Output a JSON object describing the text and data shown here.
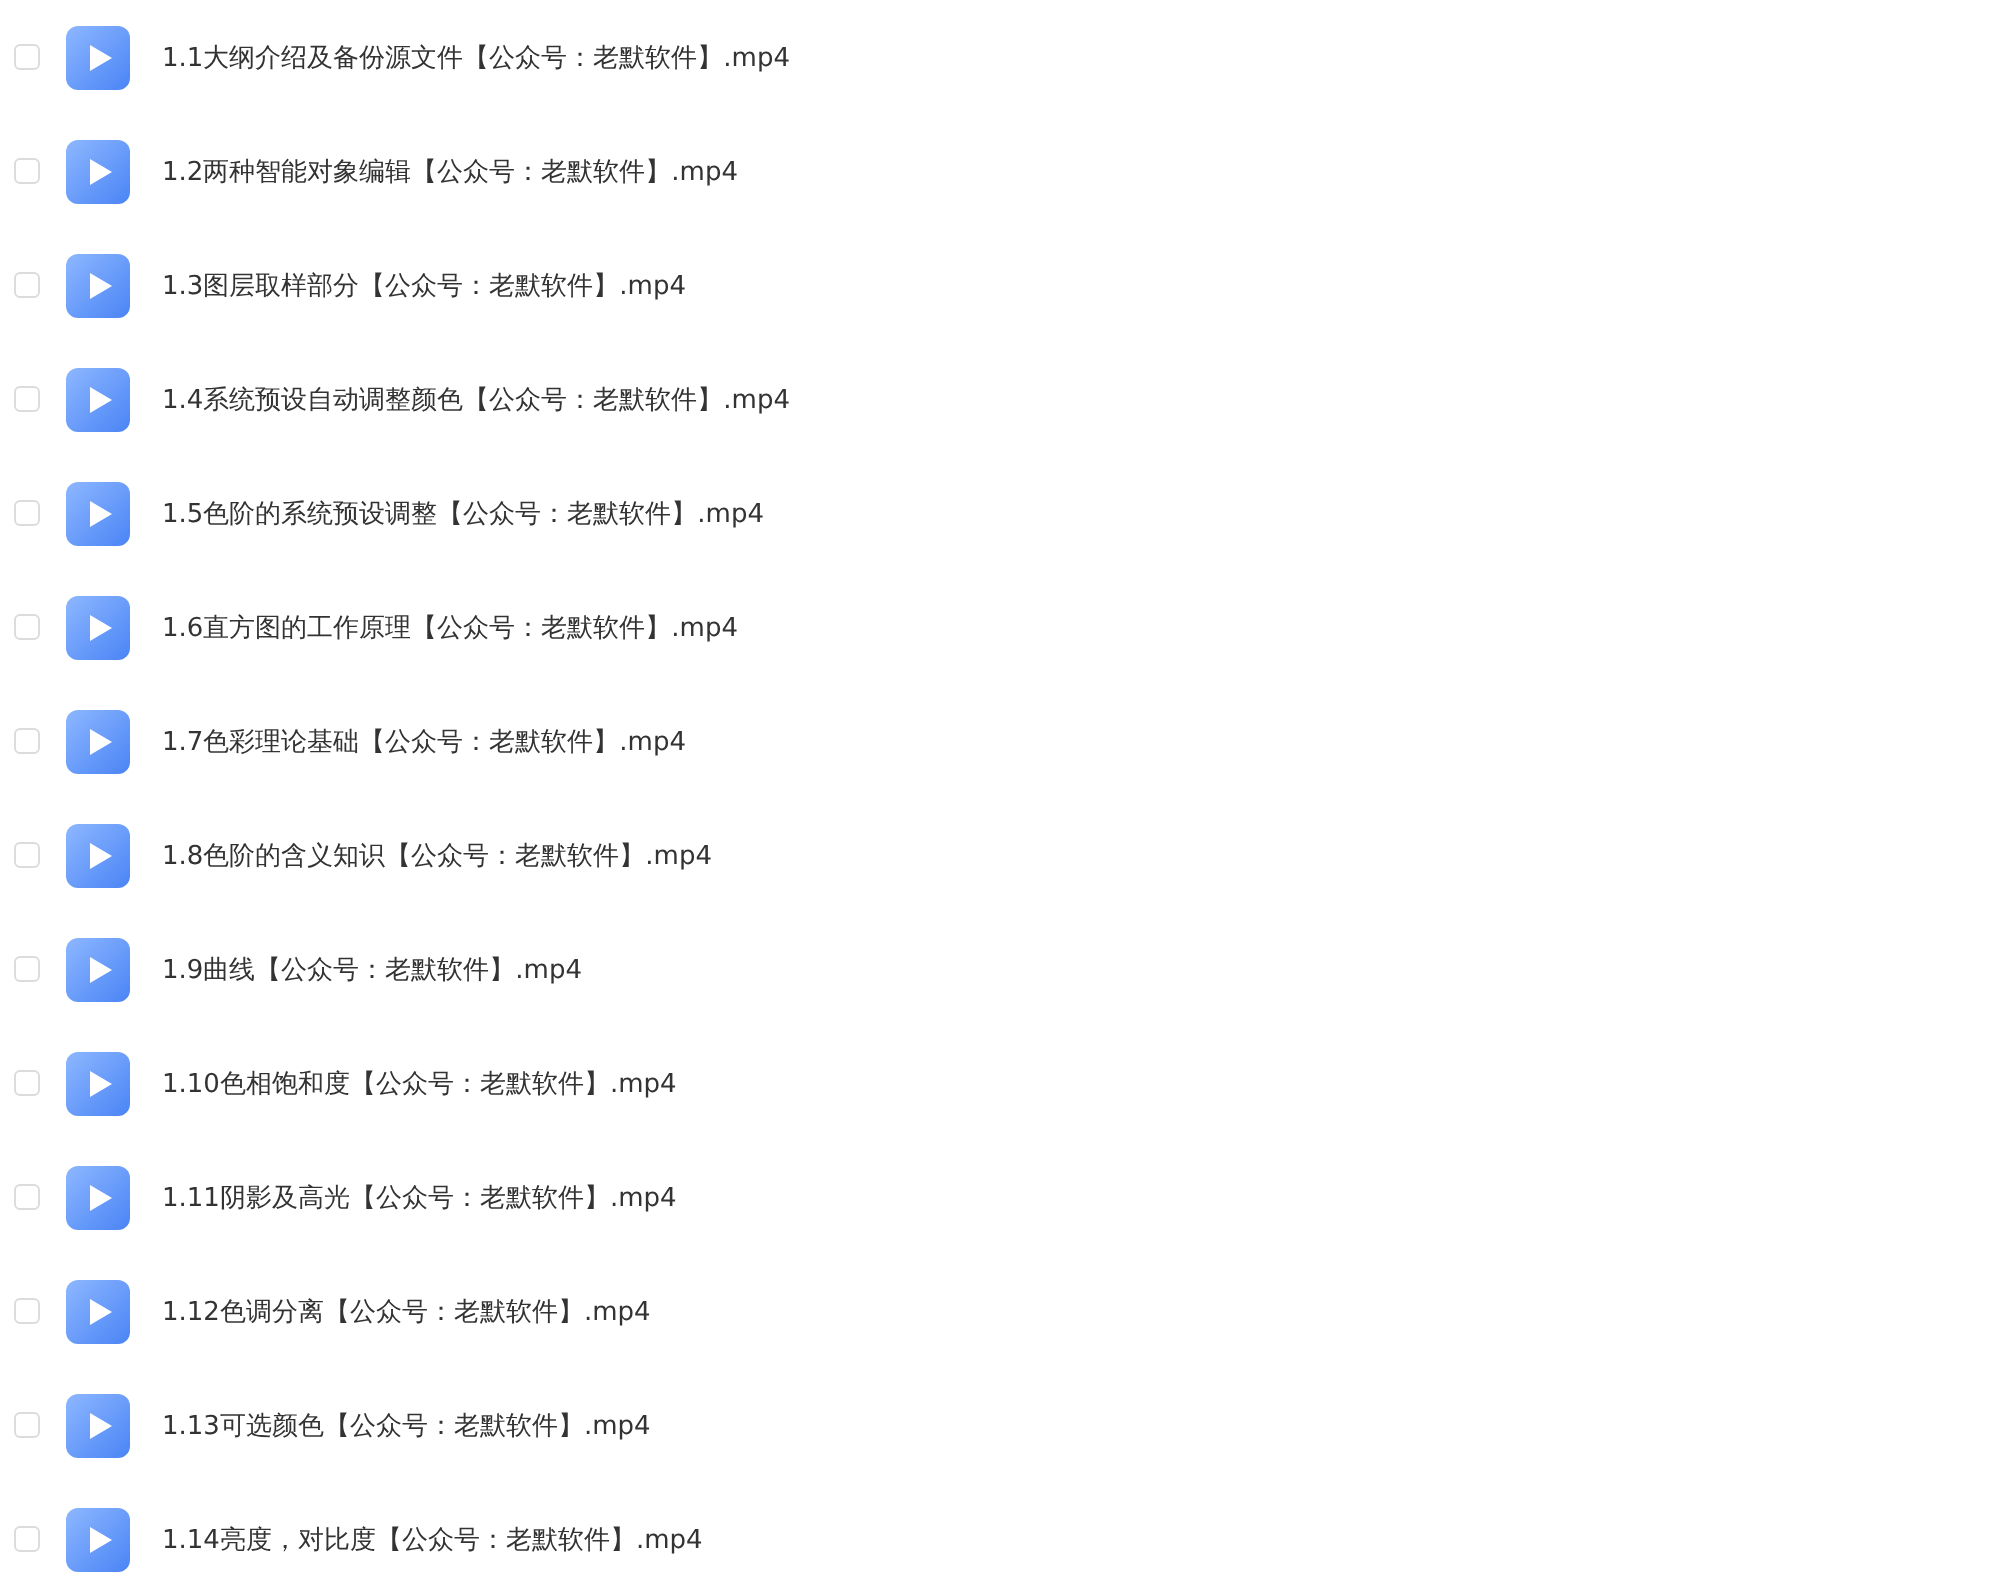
{
  "files": [
    {
      "name": "1.1大纲介绍及备份源文件【公众号：老默软件】.mp4",
      "checked": false
    },
    {
      "name": "1.2两种智能对象编辑【公众号：老默软件】.mp4",
      "checked": false
    },
    {
      "name": "1.3图层取样部分【公众号：老默软件】.mp4",
      "checked": false
    },
    {
      "name": "1.4系统预设自动调整颜色【公众号：老默软件】.mp4",
      "checked": false
    },
    {
      "name": "1.5色阶的系统预设调整【公众号：老默软件】.mp4",
      "checked": false
    },
    {
      "name": "1.6直方图的工作原理【公众号：老默软件】.mp4",
      "checked": false
    },
    {
      "name": "1.7色彩理论基础【公众号：老默软件】.mp4",
      "checked": false
    },
    {
      "name": "1.8色阶的含义知识【公众号：老默软件】.mp4",
      "checked": false
    },
    {
      "name": "1.9曲线【公众号：老默软件】.mp4",
      "checked": false
    },
    {
      "name": "1.10色相饱和度【公众号：老默软件】.mp4",
      "checked": false
    },
    {
      "name": "1.11阴影及高光【公众号：老默软件】.mp4",
      "checked": false
    },
    {
      "name": "1.12色调分离【公众号：老默软件】.mp4",
      "checked": false
    },
    {
      "name": "1.13可选颜色【公众号：老默软件】.mp4",
      "checked": false
    },
    {
      "name": "1.14亮度，对比度【公众号：老默软件】.mp4",
      "checked": false
    }
  ]
}
